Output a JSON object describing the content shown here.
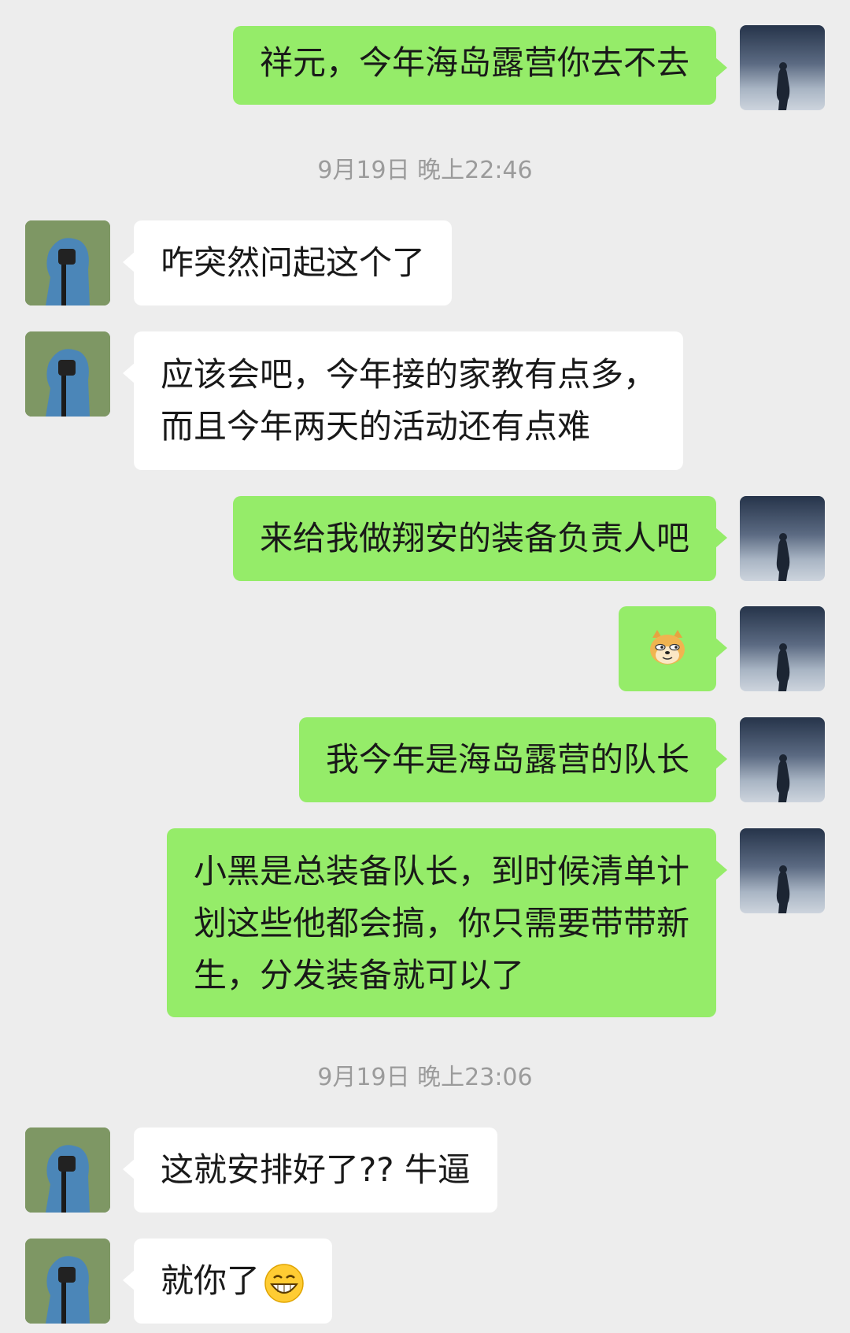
{
  "messages": [
    {
      "sender": "me",
      "type": "text",
      "lines": [
        "祥元，今年海岛露营你去不去"
      ]
    },
    {
      "type": "timestamp",
      "text": "9月19日 晚上22:46"
    },
    {
      "sender": "other",
      "type": "text",
      "lines": [
        "咋突然问起这个了"
      ]
    },
    {
      "sender": "other",
      "type": "text",
      "lines": [
        "应该会吧，今年接的家教有点多，",
        "而且今年两天的活动还有点难"
      ]
    },
    {
      "sender": "me",
      "type": "text",
      "lines": [
        "来给我做翔安的装备负责人吧"
      ]
    },
    {
      "sender": "me",
      "type": "emoji",
      "emoji": "doge-emoji"
    },
    {
      "sender": "me",
      "type": "text",
      "lines": [
        "我今年是海岛露营的队长"
      ]
    },
    {
      "sender": "me",
      "type": "text",
      "lines": [
        "小黑是总装备队长，到时候清单计",
        "划这些他都会搞，你只需要带带新",
        "生，分发装备就可以了"
      ]
    },
    {
      "type": "timestamp",
      "text": "9月19日 晚上23:06"
    },
    {
      "sender": "other",
      "type": "text",
      "lines": [
        "这就安排好了?? 牛逼"
      ]
    },
    {
      "sender": "other",
      "type": "text",
      "lines": [
        "就你了"
      ],
      "trailing_emoji": "grin-emoji"
    }
  ],
  "colors": {
    "background": "#ededed",
    "my_bubble": "#95ec69",
    "their_bubble": "#ffffff",
    "timestamp_text": "#9b9b9b"
  }
}
